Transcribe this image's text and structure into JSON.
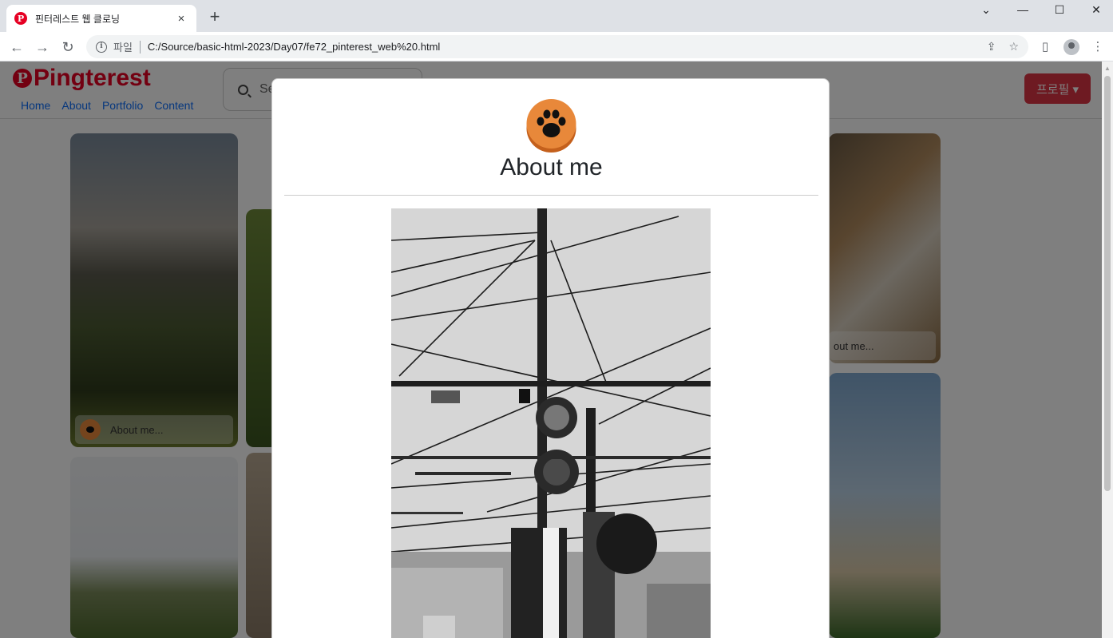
{
  "browser": {
    "tab_title": "핀터레스트 웹 클로닝",
    "favicon_glyph": "P",
    "new_tab": "+",
    "close_tab": "×",
    "scheme_label": "파일",
    "url": "C:/Source/basic-html-2023/Day07/fe72_pinterest_web%20.html",
    "window_controls": [
      "⌄",
      "—",
      "☐",
      "✕"
    ]
  },
  "site": {
    "logo_text": "Pingterest",
    "nav": [
      "Home",
      "About",
      "Portfolio",
      "Content"
    ],
    "search_placeholder": "Se",
    "profile_button": "프로필 ▾"
  },
  "cards": [
    {
      "caption": "About me..."
    },
    {
      "caption": "out me..."
    }
  ],
  "modal": {
    "title": "About me",
    "badge_icon": "paw-icon",
    "photo_description_icon": "photo"
  },
  "colors": {
    "brand": "#e60023",
    "profile_button": "#dc3545",
    "badge_orange": "#e8883a"
  }
}
